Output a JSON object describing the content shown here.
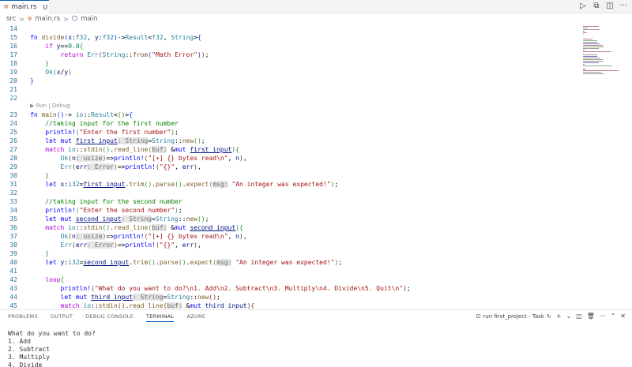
{
  "tab": {
    "icon": "rs-file-icon",
    "filename": "main.rs",
    "status": "U"
  },
  "toolbar": {
    "icons": [
      "run-icon",
      "split-compare-icon",
      "split-editor-icon",
      "more-icon"
    ],
    "glyphs": [
      "▷",
      "⧉",
      "◫",
      "···"
    ]
  },
  "breadcrumb": {
    "folder": "src",
    "file": "main.rs",
    "symbol": "main",
    "sep": ">"
  },
  "codelens": "▶ Run | Debug",
  "lines": [
    {
      "n": "14",
      "code": []
    },
    {
      "n": "15",
      "code": [
        [
          "kw",
          "fn "
        ],
        [
          "fn2",
          "divide"
        ],
        [
          "br1",
          "("
        ],
        [
          "var",
          "x"
        ],
        [
          "pun",
          ":"
        ],
        [
          "ty",
          "f32"
        ],
        [
          "pun",
          ", "
        ],
        [
          "var",
          "y"
        ],
        [
          "pun",
          ":"
        ],
        [
          "ty",
          "f32"
        ],
        [
          "br1",
          ")"
        ],
        [
          "pun",
          "->"
        ],
        [
          "ty",
          "Result"
        ],
        [
          "pun",
          "<"
        ],
        [
          "ty",
          "f32"
        ],
        [
          "pun",
          ", "
        ],
        [
          "ty",
          "String"
        ],
        [
          "pun",
          ">"
        ],
        [
          "br1",
          "{"
        ]
      ]
    },
    {
      "n": "16",
      "code": [
        [
          "pun",
          "    "
        ],
        [
          "ctrl",
          "if "
        ],
        [
          "var",
          "y"
        ],
        [
          "pun",
          "=="
        ],
        [
          "num",
          "0.0"
        ],
        [
          "br2",
          "{"
        ]
      ]
    },
    {
      "n": "17",
      "code": [
        [
          "pun",
          "        "
        ],
        [
          "ctrl",
          "return "
        ],
        [
          "ty",
          "Err"
        ],
        [
          "br3",
          "("
        ],
        [
          "ty",
          "String"
        ],
        [
          "pun",
          "::"
        ],
        [
          "fn2",
          "from"
        ],
        [
          "br1",
          "("
        ],
        [
          "str",
          "\"Math Error\""
        ],
        [
          "br1",
          ")"
        ],
        [
          "br3",
          ")"
        ],
        [
          "pun",
          ";"
        ]
      ]
    },
    {
      "n": "18",
      "code": [
        [
          "pun",
          "    "
        ],
        [
          "br2",
          "}"
        ]
      ]
    },
    {
      "n": "19",
      "code": [
        [
          "pun",
          "    "
        ],
        [
          "ty",
          "Ok"
        ],
        [
          "br2",
          "("
        ],
        [
          "var",
          "x"
        ],
        [
          "pun",
          "/"
        ],
        [
          "var",
          "y"
        ],
        [
          "br2",
          ")"
        ]
      ]
    },
    {
      "n": "20",
      "code": [
        [
          "br1",
          "}"
        ]
      ]
    },
    {
      "n": "21",
      "code": []
    },
    {
      "n": "22",
      "code": []
    },
    {
      "n": "23",
      "code": [
        [
          "kw",
          "fn "
        ],
        [
          "fn2",
          "main"
        ],
        [
          "br1",
          "()"
        ],
        [
          "pun",
          "-> "
        ],
        [
          "ty",
          "io"
        ],
        [
          "pun",
          "::"
        ],
        [
          "ty",
          "Result"
        ],
        [
          "pun",
          "<"
        ],
        [
          "br2",
          "()"
        ],
        [
          "pun",
          ">"
        ],
        [
          "br1",
          "{"
        ]
      ]
    },
    {
      "n": "24",
      "code": [
        [
          "pun",
          "    "
        ],
        [
          "cm",
          "//taking input for the first number"
        ]
      ]
    },
    {
      "n": "25",
      "code": [
        [
          "pun",
          "    "
        ],
        [
          "mac",
          "println!"
        ],
        [
          "br2",
          "("
        ],
        [
          "str",
          "\"Enter the first number\""
        ],
        [
          "br2",
          ")"
        ],
        [
          "pun",
          ";"
        ]
      ]
    },
    {
      "n": "26",
      "code": [
        [
          "pun",
          "    "
        ],
        [
          "kw",
          "let mut "
        ],
        [
          "ul",
          "first_input"
        ],
        [
          "hint",
          ": String"
        ],
        [
          "pun",
          "="
        ],
        [
          "ty",
          "String"
        ],
        [
          "pun",
          "::"
        ],
        [
          "fn2",
          "new"
        ],
        [
          "br2",
          "()"
        ],
        [
          "pun",
          ";"
        ]
      ]
    },
    {
      "n": "27",
      "code": [
        [
          "pun",
          "    "
        ],
        [
          "ctrl",
          "match "
        ],
        [
          "ty",
          "io"
        ],
        [
          "pun",
          "::"
        ],
        [
          "fn2",
          "stdin"
        ],
        [
          "br2",
          "()"
        ],
        [
          "pun",
          "."
        ],
        [
          "fn2",
          "read_line"
        ],
        [
          "br2",
          "("
        ],
        [
          "hint",
          "buf:"
        ],
        [
          "pun",
          " &"
        ],
        [
          "kw",
          "mut "
        ],
        [
          "ul",
          "first_input"
        ],
        [
          "br2",
          ")"
        ],
        [
          "br2",
          "{"
        ]
      ]
    },
    {
      "n": "28",
      "code": [
        [
          "pun",
          "        "
        ],
        [
          "ty",
          "Ok"
        ],
        [
          "br3",
          "("
        ],
        [
          "var",
          "n"
        ],
        [
          "hint",
          ": usize"
        ],
        [
          "br3",
          ")"
        ],
        [
          "pun",
          "=>"
        ],
        [
          "mac",
          "println!"
        ],
        [
          "br3",
          "("
        ],
        [
          "str",
          "\"[+] {} bytes read\\n\""
        ],
        [
          "pun",
          ", "
        ],
        [
          "var",
          "n"
        ],
        [
          "br3",
          ")"
        ],
        [
          "pun",
          ","
        ]
      ]
    },
    {
      "n": "29",
      "code": [
        [
          "pun",
          "        "
        ],
        [
          "ty",
          "Err"
        ],
        [
          "br3",
          "("
        ],
        [
          "var",
          "err"
        ],
        [
          "hint",
          ": Error"
        ],
        [
          "br3",
          ")"
        ],
        [
          "pun",
          "=>"
        ],
        [
          "mac",
          "println!"
        ],
        [
          "br3",
          "("
        ],
        [
          "str",
          "\"{}\""
        ],
        [
          "pun",
          ", "
        ],
        [
          "var",
          "err"
        ],
        [
          "br3",
          ")"
        ],
        [
          "pun",
          ","
        ]
      ]
    },
    {
      "n": "30",
      "code": [
        [
          "pun",
          "    "
        ],
        [
          "br2",
          "}"
        ]
      ]
    },
    {
      "n": "31",
      "code": [
        [
          "pun",
          "    "
        ],
        [
          "kw",
          "let "
        ],
        [
          "var",
          "x"
        ],
        [
          "pun",
          ":"
        ],
        [
          "ty",
          "i32"
        ],
        [
          "pun",
          "="
        ],
        [
          "ul",
          "first_input"
        ],
        [
          "pun",
          "."
        ],
        [
          "fn2",
          "trim"
        ],
        [
          "br2",
          "()"
        ],
        [
          "pun",
          "."
        ],
        [
          "fn2",
          "parse"
        ],
        [
          "br2",
          "()"
        ],
        [
          "pun",
          "."
        ],
        [
          "fn2",
          "expect"
        ],
        [
          "br2",
          "("
        ],
        [
          "hint",
          "msg:"
        ],
        [
          "str",
          " \"An integer was expected!\""
        ],
        [
          "br2",
          ")"
        ],
        [
          "pun",
          ";"
        ]
      ]
    },
    {
      "n": "32",
      "code": []
    },
    {
      "n": "33",
      "code": [
        [
          "pun",
          "    "
        ],
        [
          "cm",
          "//taking input for the second number"
        ]
      ]
    },
    {
      "n": "34",
      "code": [
        [
          "pun",
          "    "
        ],
        [
          "mac",
          "println!"
        ],
        [
          "br2",
          "("
        ],
        [
          "str",
          "\"Enter the second number\""
        ],
        [
          "br2",
          ")"
        ],
        [
          "pun",
          ";"
        ]
      ]
    },
    {
      "n": "35",
      "code": [
        [
          "pun",
          "    "
        ],
        [
          "kw",
          "let mut "
        ],
        [
          "ul",
          "second_input"
        ],
        [
          "hint",
          ": String"
        ],
        [
          "pun",
          "="
        ],
        [
          "ty",
          "String"
        ],
        [
          "pun",
          "::"
        ],
        [
          "fn2",
          "new"
        ],
        [
          "br2",
          "()"
        ],
        [
          "pun",
          ";"
        ]
      ]
    },
    {
      "n": "36",
      "code": [
        [
          "pun",
          "    "
        ],
        [
          "ctrl",
          "match "
        ],
        [
          "ty",
          "io"
        ],
        [
          "pun",
          "::"
        ],
        [
          "fn2",
          "stdin"
        ],
        [
          "br2",
          "()"
        ],
        [
          "pun",
          "."
        ],
        [
          "fn2",
          "read_line"
        ],
        [
          "br2",
          "("
        ],
        [
          "hint",
          "buf:"
        ],
        [
          "pun",
          " &"
        ],
        [
          "kw",
          "mut "
        ],
        [
          "ul",
          "second_input"
        ],
        [
          "br2",
          ")"
        ],
        [
          "br2",
          "{"
        ]
      ]
    },
    {
      "n": "37",
      "code": [
        [
          "pun",
          "        "
        ],
        [
          "ty",
          "Ok"
        ],
        [
          "br3",
          "("
        ],
        [
          "var",
          "n"
        ],
        [
          "hint",
          ": usize"
        ],
        [
          "br3",
          ")"
        ],
        [
          "pun",
          "=>"
        ],
        [
          "mac",
          "println!"
        ],
        [
          "br3",
          "("
        ],
        [
          "str",
          "\"[+] {} bytes read\\n\""
        ],
        [
          "pun",
          ", "
        ],
        [
          "var",
          "n"
        ],
        [
          "br3",
          ")"
        ],
        [
          "pun",
          ","
        ]
      ]
    },
    {
      "n": "38",
      "code": [
        [
          "pun",
          "        "
        ],
        [
          "ty",
          "Err"
        ],
        [
          "br3",
          "("
        ],
        [
          "var",
          "err"
        ],
        [
          "hint",
          ": Error"
        ],
        [
          "br3",
          ")"
        ],
        [
          "pun",
          "=>"
        ],
        [
          "mac",
          "println!"
        ],
        [
          "br3",
          "("
        ],
        [
          "str",
          "\"{}\""
        ],
        [
          "pun",
          ", "
        ],
        [
          "var",
          "err"
        ],
        [
          "br3",
          ")"
        ],
        [
          "pun",
          ","
        ]
      ]
    },
    {
      "n": "39",
      "code": [
        [
          "pun",
          "    "
        ],
        [
          "br2",
          "}"
        ]
      ]
    },
    {
      "n": "40",
      "code": [
        [
          "pun",
          "    "
        ],
        [
          "kw",
          "let "
        ],
        [
          "var",
          "y"
        ],
        [
          "pun",
          ":"
        ],
        [
          "ty",
          "i32"
        ],
        [
          "pun",
          "="
        ],
        [
          "ul",
          "second_input"
        ],
        [
          "pun",
          "."
        ],
        [
          "fn2",
          "trim"
        ],
        [
          "br2",
          "()"
        ],
        [
          "pun",
          "."
        ],
        [
          "fn2",
          "parse"
        ],
        [
          "br2",
          "()"
        ],
        [
          "pun",
          "."
        ],
        [
          "fn2",
          "expect"
        ],
        [
          "br2",
          "("
        ],
        [
          "hint",
          "msg:"
        ],
        [
          "str",
          " \"An integer was expected!\""
        ],
        [
          "br2",
          ")"
        ],
        [
          "pun",
          ";"
        ]
      ]
    },
    {
      "n": "41",
      "code": []
    },
    {
      "n": "42",
      "code": [
        [
          "pun",
          "    "
        ],
        [
          "ctrl",
          "loop"
        ],
        [
          "br2",
          "{"
        ]
      ]
    },
    {
      "n": "43",
      "code": [
        [
          "pun",
          "        "
        ],
        [
          "mac",
          "println!"
        ],
        [
          "br3",
          "("
        ],
        [
          "str",
          "\"What do you want to do?\\n1. Add\\n2. Subtract\\n3. Multiply\\n4. Divide\\n5. Quit\\n\""
        ],
        [
          "br3",
          ")"
        ],
        [
          "pun",
          ";"
        ]
      ]
    },
    {
      "n": "44",
      "code": [
        [
          "pun",
          "        "
        ],
        [
          "kw",
          "let mut "
        ],
        [
          "ul",
          "third_input"
        ],
        [
          "hint",
          ": String"
        ],
        [
          "pun",
          "="
        ],
        [
          "ty",
          "String"
        ],
        [
          "pun",
          "::"
        ],
        [
          "fn2",
          "new"
        ],
        [
          "br3",
          "()"
        ],
        [
          "pun",
          ";"
        ]
      ]
    },
    {
      "n": "45",
      "code": [
        [
          "pun",
          "        "
        ],
        [
          "ctrl",
          "match "
        ],
        [
          "ty",
          "io"
        ],
        [
          "pun",
          "::"
        ],
        [
          "fn2",
          "stdin"
        ],
        [
          "br3",
          "()"
        ],
        [
          "pun",
          "."
        ],
        [
          "fn2",
          "read_line"
        ],
        [
          "br3",
          "("
        ],
        [
          "hint",
          "buf:"
        ],
        [
          "pun",
          " &"
        ],
        [
          "kw",
          "mut "
        ],
        [
          "ul",
          "third_input"
        ],
        [
          "br3",
          ")"
        ],
        [
          "br3",
          "{"
        ]
      ]
    }
  ],
  "panel": {
    "tabs": [
      {
        "id": "problems",
        "label": "PROBLEMS",
        "active": false
      },
      {
        "id": "output",
        "label": "OUTPUT",
        "active": false
      },
      {
        "id": "debug-console",
        "label": "DEBUG CONSOLE",
        "active": false
      },
      {
        "id": "terminal",
        "label": "TERMINAL",
        "active": true
      },
      {
        "id": "azure",
        "label": "AZURE",
        "active": false
      }
    ],
    "task_label": "run first_project - Task",
    "tool_glyphs": {
      "plus": "+",
      "chevron": "⌄",
      "split": "◫",
      "trash": "🗑",
      "more": "···",
      "up": "⌃",
      "close": "✕"
    },
    "terminal_lines": [
      "What do you want to do?",
      "1. Add",
      "2. Subtract",
      "3. Multiply",
      "4. Divide"
    ]
  }
}
